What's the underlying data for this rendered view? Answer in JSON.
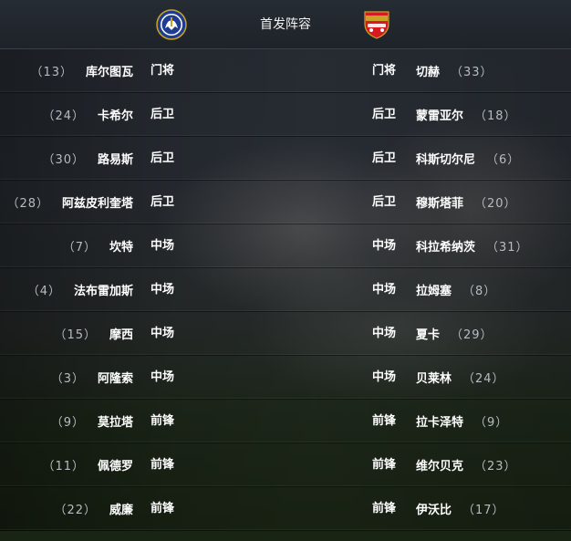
{
  "header": {
    "title": "首发阵容",
    "home_crest_icon": "chelsea-crest-icon",
    "away_crest_icon": "arsenal-crest-icon"
  },
  "colors": {
    "header_bg": "#1e2329",
    "text": "#ffffff",
    "number_text": "#b8bcc2"
  },
  "rows": [
    {
      "home_number": "（13）",
      "home_name": "库尔图瓦",
      "home_pos": "门将",
      "away_pos": "门将",
      "away_name": "切赫",
      "away_number": "（33）"
    },
    {
      "home_number": "（24）",
      "home_name": "卡希尔",
      "home_pos": "后卫",
      "away_pos": "后卫",
      "away_name": "蒙雷亚尔",
      "away_number": "（18）"
    },
    {
      "home_number": "（30）",
      "home_name": "路易斯",
      "home_pos": "后卫",
      "away_pos": "后卫",
      "away_name": "科斯切尔尼",
      "away_number": "（6）"
    },
    {
      "home_number": "（28）",
      "home_name": "阿兹皮利奎塔",
      "home_pos": "后卫",
      "away_pos": "后卫",
      "away_name": "穆斯塔菲",
      "away_number": "（20）"
    },
    {
      "home_number": "（7）",
      "home_name": "坎特",
      "home_pos": "中场",
      "away_pos": "中场",
      "away_name": "科拉希纳茨",
      "away_number": "（31）"
    },
    {
      "home_number": "（4）",
      "home_name": "法布雷加斯",
      "home_pos": "中场",
      "away_pos": "中场",
      "away_name": "拉姆塞",
      "away_number": "（8）"
    },
    {
      "home_number": "（15）",
      "home_name": "摩西",
      "home_pos": "中场",
      "away_pos": "中场",
      "away_name": "夏卡",
      "away_number": "（29）"
    },
    {
      "home_number": "（3）",
      "home_name": "阿隆索",
      "home_pos": "中场",
      "away_pos": "中场",
      "away_name": "贝莱林",
      "away_number": "（24）"
    },
    {
      "home_number": "（9）",
      "home_name": "莫拉塔",
      "home_pos": "前锋",
      "away_pos": "前锋",
      "away_name": "拉卡泽特",
      "away_number": "（9）"
    },
    {
      "home_number": "（11）",
      "home_name": "佩德罗",
      "home_pos": "前锋",
      "away_pos": "前锋",
      "away_name": "维尔贝克",
      "away_number": "（23）"
    },
    {
      "home_number": "（22）",
      "home_name": "威廉",
      "home_pos": "前锋",
      "away_pos": "前锋",
      "away_name": "伊沃比",
      "away_number": "（17）"
    }
  ]
}
